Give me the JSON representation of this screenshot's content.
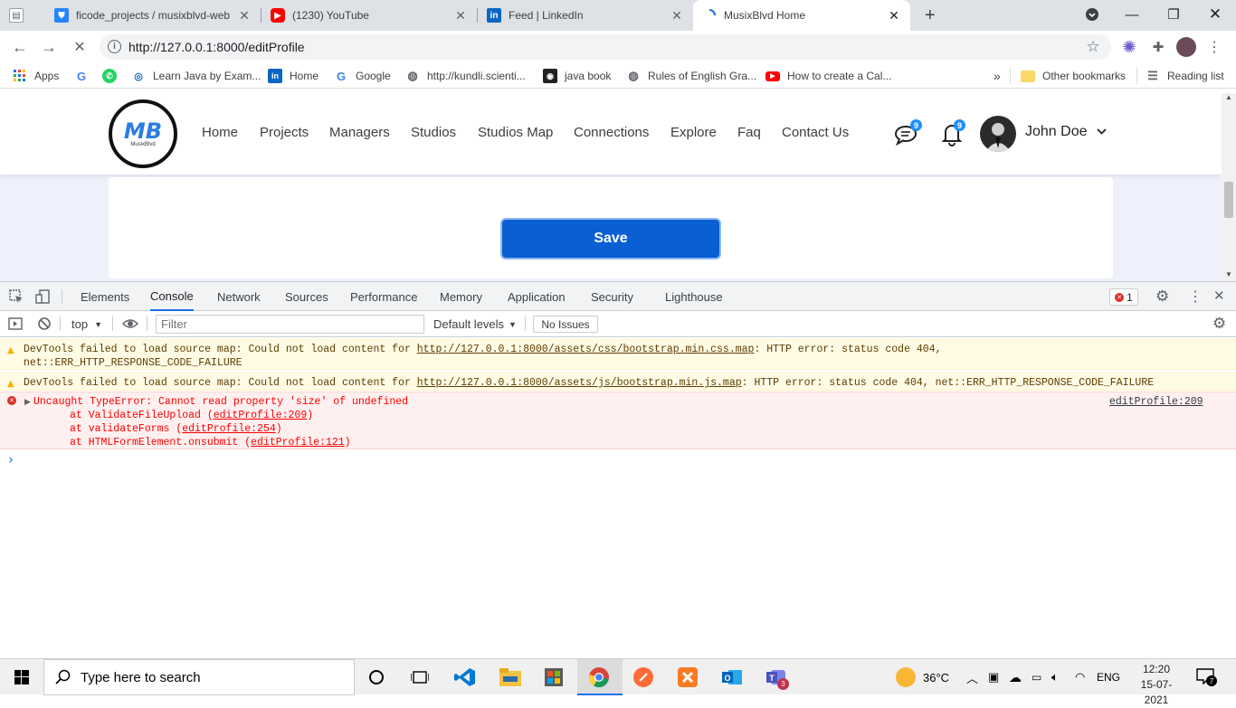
{
  "browser": {
    "tabs": [
      {
        "title": "ficode_projects / musixblvd-web",
        "favicon": "bitbucket-icon",
        "color": "#2684ff"
      },
      {
        "title": "(1230) YouTube",
        "favicon": "youtube-icon",
        "color": "#ff0000"
      },
      {
        "title": "Feed | LinkedIn",
        "favicon": "linkedin-icon",
        "color": "#0a66c2"
      },
      {
        "title": "MusixBlvd Home",
        "favicon": "loading-spinner-icon",
        "color": "#1a73e8",
        "active": true
      }
    ],
    "address": "http://127.0.0.1:8000/editProfile",
    "bookmarks": [
      {
        "label": "Apps",
        "icon": "apps-grid-icon"
      },
      {
        "label": "",
        "icon": "google-icon"
      },
      {
        "label": "",
        "icon": "whatsapp-icon"
      },
      {
        "label": "Learn Java by Exam...",
        "icon": "java-site-icon"
      },
      {
        "label": "Home",
        "icon": "linkedin-icon"
      },
      {
        "label": "Google",
        "icon": "google-icon"
      },
      {
        "label": "http://kundli.scienti...",
        "icon": "globe-icon"
      },
      {
        "label": "java book",
        "icon": "book-icon"
      },
      {
        "label": "Rules of English Gra...",
        "icon": "globe-icon"
      },
      {
        "label": "How to create a Cal...",
        "icon": "youtube-icon"
      }
    ],
    "overflow": "»",
    "other_bookmarks": "Other bookmarks",
    "reading_list": "Reading list"
  },
  "site": {
    "logo_text": "MB",
    "logo_sub": "MusixBlvd",
    "nav": [
      "Home",
      "Projects",
      "Managers",
      "Studios",
      "Studios Map",
      "Connections",
      "Explore",
      "Faq",
      "Contact Us"
    ],
    "messages_badge": "9",
    "notifications_badge": "9",
    "user_name": "John Doe",
    "save_label": "Save"
  },
  "devtools": {
    "tabs": [
      "Elements",
      "Console",
      "Network",
      "Sources",
      "Performance",
      "Memory",
      "Application",
      "Security",
      "Lighthouse"
    ],
    "active_tab": "Console",
    "error_count": "1",
    "context": "top",
    "filter_placeholder": "Filter",
    "levels": "Default levels",
    "issues": "No Issues",
    "messages": {
      "w1_a": "DevTools failed to load source map: Could not load content for ",
      "w1_link": "http://127.0.0.1:8000/assets/css/bootstrap.min.css.map",
      "w1_b": ": HTTP error: status code 404,",
      "w1_c": "net::ERR_HTTP_RESPONSE_CODE_FAILURE",
      "w2_a": "DevTools failed to load source map: Could not load content for ",
      "w2_link": "http://127.0.0.1:8000/assets/js/bootstrap.min.js.map",
      "w2_b": ": HTTP error: status code 404, net::ERR_HTTP_RESPONSE_CODE_FAILURE",
      "e_main": "Uncaught TypeError: Cannot read property 'size' of undefined",
      "e_src": "editProfile:209",
      "e_s1_a": "at ValidateFileUpload (",
      "e_s1_link": "editProfile:209",
      "e_s2_a": "at validateForms (",
      "e_s2_link": "editProfile:254",
      "e_s3_a": "at HTMLFormElement.onsubmit (",
      "e_s3_link": "editProfile:121",
      "close_paren": ")",
      "prompt": "›"
    }
  },
  "taskbar": {
    "search_placeholder": "Type here to search",
    "weather": "36°C",
    "lang": "ENG",
    "time": "12:20",
    "date": "15-07-2021",
    "notifications": "7",
    "teams_badge": "3"
  }
}
